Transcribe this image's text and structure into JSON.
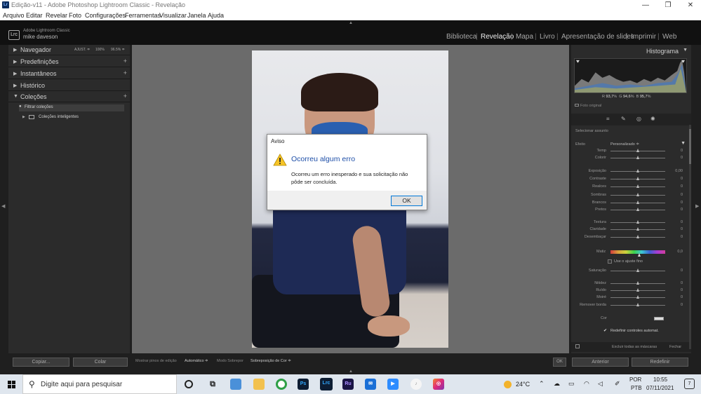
{
  "window": {
    "title": "Edição-v11 - Adobe Photoshop Lightroom Classic - Revelação",
    "minimize": "—",
    "maximize": "❐",
    "close": "✕"
  },
  "menu": [
    "Arquivo",
    "Editar",
    "Revelar",
    "Foto",
    "Configurações",
    "Ferramentas",
    "Visualizar",
    "Janela",
    "Ajuda"
  ],
  "identity": {
    "badge": "Lrc",
    "product": "Adobe Lightroom Classic",
    "user": "mike daveson"
  },
  "modules": [
    "Biblioteca",
    "Revelação",
    "Mapa",
    "Livro",
    "Apresentação de slides",
    "Imprimir",
    "Web"
  ],
  "active_module": "Revelação",
  "left_panel": {
    "sections": [
      {
        "label": "Navegador",
        "extras": [
          "AJUST. ≑",
          "100%",
          "96.5% ≑"
        ]
      },
      {
        "label": "Predefinições",
        "plus": "+"
      },
      {
        "label": "Instantâneos",
        "plus": "+"
      },
      {
        "label": "Histórico"
      },
      {
        "label": "Coleções",
        "plus": "+"
      }
    ],
    "collections": [
      "Filtrar coleções",
      "Coleções inteligentes"
    ],
    "copy_button": "Copiar...",
    "paste_button": "Colar"
  },
  "dialog": {
    "title": "Aviso",
    "heading": "Ocorreu algum erro",
    "message": "Ocorreu um erro inesperado e sua solicitação não pôde ser concluída.",
    "ok_button": "OK",
    "icon": "warning-icon"
  },
  "right_panel": {
    "histogram_title": "Histograma",
    "readout": {
      "r_label": "R",
      "r": "93,7",
      "g_label": "G",
      "g": "94,6",
      "b_label": "B",
      "b": "95,7",
      "unit": "%"
    },
    "original_photo": "Foto original",
    "select_subject": "Selecionar assunto",
    "effect_label": "Efeito",
    "effect_value": "Personalizado ≑",
    "sliders": [
      {
        "label": "Temp",
        "value": "0",
        "pos": 0.5
      },
      {
        "label": "Colorir",
        "value": "0",
        "pos": 0.5
      },
      {
        "label": "Exposição",
        "value": "0,00",
        "pos": 0.5
      },
      {
        "label": "Contraste",
        "value": "0",
        "pos": 0.5
      },
      {
        "label": "Realces",
        "value": "0",
        "pos": 0.5
      },
      {
        "label": "Sombras",
        "value": "0",
        "pos": 0.5
      },
      {
        "label": "Brancos",
        "value": "0",
        "pos": 0.5
      },
      {
        "label": "Pretos",
        "value": "0",
        "pos": 0.5
      },
      {
        "label": "Textura",
        "value": "0",
        "pos": 0.5
      },
      {
        "label": "Claridade",
        "value": "0",
        "pos": 0.5
      },
      {
        "label": "Desembaçar",
        "value": "0",
        "pos": 0.5
      },
      {
        "label": "Saturação",
        "value": "0",
        "pos": 0.5
      },
      {
        "label": "Nitidez",
        "value": "0",
        "pos": 0.5
      },
      {
        "label": "Ruído",
        "value": "0",
        "pos": 0.5
      },
      {
        "label": "Moiré",
        "value": "0",
        "pos": 0.5
      },
      {
        "label": "Remover borda",
        "value": "0",
        "pos": 0.5
      }
    ],
    "hue_label": "Matiz",
    "hue_value": "0,0",
    "fine_adjust": "Use o ajuste fino",
    "color_label": "Cor",
    "auto_reset": "Redefinir controles automat.",
    "clear_masks": "Excluir todas as máscaras",
    "close": "Fechar"
  },
  "bottom_bar": {
    "show_pins": "Mostrar pinos de edição",
    "pins_value": "Automático ≑",
    "overlay_mode": "Modo Sobrepor",
    "overlay_value": "Sobreposição de Cor ≑",
    "ok": "OK",
    "previous": "Anterior",
    "reset": "Redefinir"
  },
  "taskbar": {
    "search_placeholder": "Digite aqui para pesquisar",
    "apps": [
      "Ps",
      "Lrc",
      "Ru"
    ],
    "temperature": "24°C",
    "language": "POR",
    "layout": "PTB",
    "time": "10:55",
    "date": "07/11/2021",
    "notifications": "7"
  },
  "colors": {
    "dialog_heading": "#1e4fa8",
    "ok_border": "#0078d7",
    "panel_bg": "#2b2b2b",
    "center_bg": "#6b6b6b"
  }
}
